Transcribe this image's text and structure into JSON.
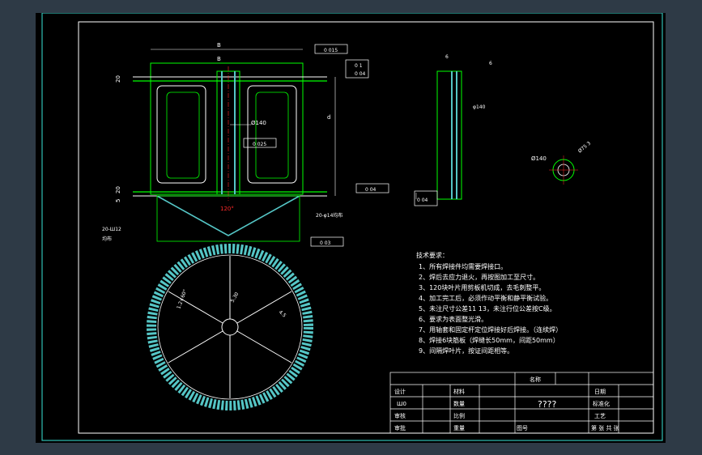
{
  "colors": {
    "background": "#2e3a46",
    "sheet": "#000000",
    "frame": "#2fbfb3",
    "outline": "#00ff00",
    "annotation": "#ffffff",
    "highlight": "#ff2a2a",
    "weld_fill": "#55c6c6"
  },
  "front_view": {
    "dim_top_1": "B",
    "dim_top_2": "B",
    "dim_left_top": "20",
    "dim_left_bottom": "20",
    "dim_left_side": "5",
    "dim_right": "d",
    "bore_dim": "Ø140",
    "tol_top": "0 015",
    "tol_center": "0 025",
    "tol_right": "0 04",
    "tol_bottom": "0 03",
    "gdt_line1": "0 1",
    "gdt_line2": "0 04",
    "angle": "120°",
    "weld_left_note": "20-Ш12",
    "weld_left_note2": "均布",
    "weld_right_note": "20-φ14均布"
  },
  "side_view": {
    "tol": "0 04",
    "bore_dim": "φ140",
    "weld": "6",
    "angle_note": "6"
  },
  "detail_view": {
    "bore_dim": "Ø140",
    "dim_right": "Ø75 3"
  },
  "top_view": {
    "label_r1": "1.2×60°",
    "label_r2": "5.30",
    "label_r3": "4.5"
  },
  "tech_requirements": {
    "title": "技术要求：",
    "items": [
      "1、所有焊接件均需要焊接口。",
      "2、焊后去应力退火，再按图加工至尺寸。",
      "3、120块叶片用剪板机切成，去毛刺整平。",
      "4、加工完工后，必须作动平衡和静平衡试验。",
      "5、未注尺寸公差11 13，未注行位公差按C级。",
      "6、要求为表面整光滑。",
      "7、用轴套和固定杆定位焊接好后焊接。（连续焊）",
      "8、焊接6块筋板（焊缝长50mm，间距50mm）",
      "9、间隔焊叶片，按证间距相等。"
    ]
  },
  "title_block": {
    "name_label": "名称",
    "design": "设计",
    "material_label": "材料",
    "date_label": "日期",
    "drawn": "Ш0",
    "quantity": "数量",
    "standard": "标准化",
    "drawing_name": "????",
    "check": "审核",
    "scale": "比例",
    "process": "工艺",
    "approve": "审批",
    "weight": "重量",
    "drawing_no": "图号",
    "sheets": "第  张  共  张"
  }
}
